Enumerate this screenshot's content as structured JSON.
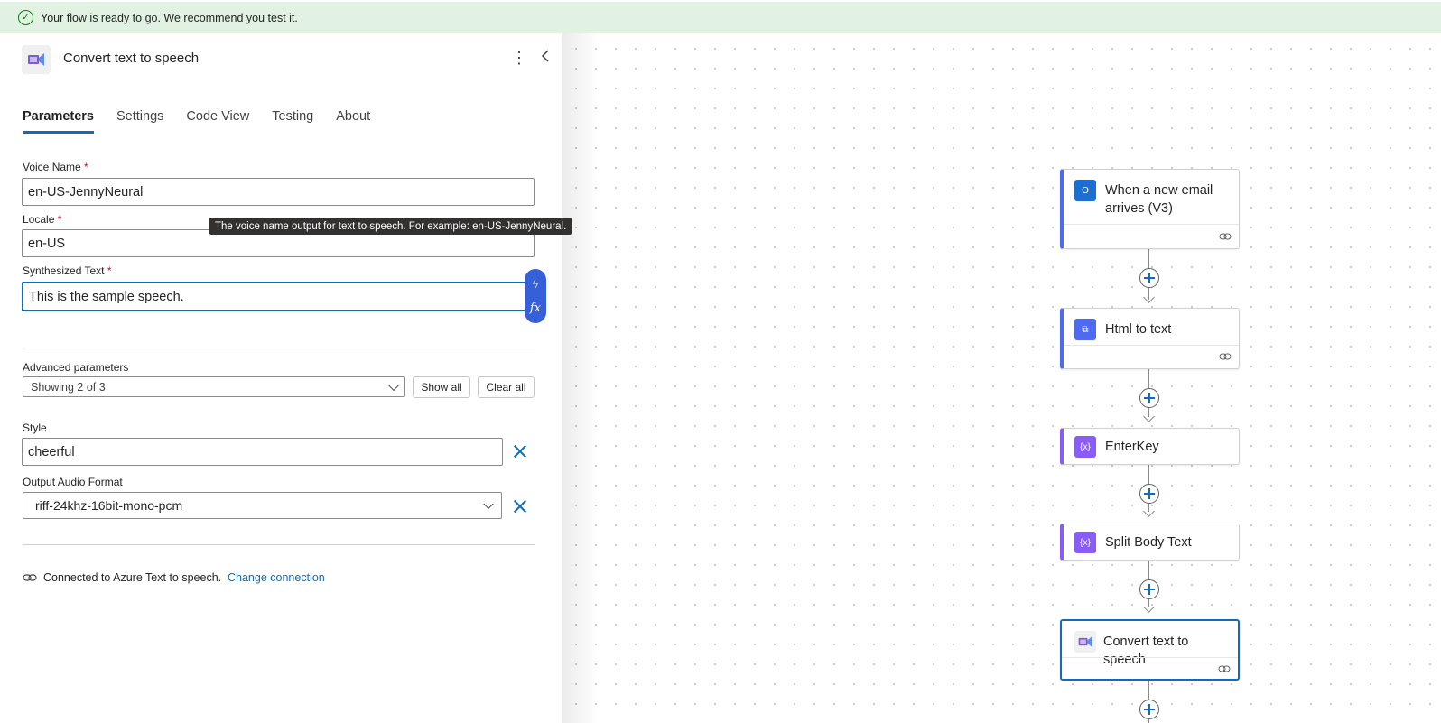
{
  "banner": {
    "message": "Your flow is ready to go. We recommend you test it."
  },
  "panel": {
    "title": "Convert text to speech",
    "tabs": [
      {
        "label": "Parameters",
        "active": true
      },
      {
        "label": "Settings",
        "active": false
      },
      {
        "label": "Code View",
        "active": false
      },
      {
        "label": "Testing",
        "active": false
      },
      {
        "label": "About",
        "active": false
      }
    ],
    "fields": {
      "voice_name": {
        "label": "Voice Name",
        "value": "en-US-JennyNeural",
        "required": "*"
      },
      "locale": {
        "label": "Locale",
        "value": "en-US",
        "required": "*"
      },
      "synth_text": {
        "label": "Synthesized Text",
        "value": "This is the sample speech.",
        "required": "*"
      }
    },
    "tooltip": "The voice name output for text to speech. For example: en-US-JennyNeural.",
    "token_icons": {
      "dynamic": "ϟ",
      "expression": "fx"
    },
    "advanced": {
      "label": "Advanced parameters",
      "selected": "Showing 2 of 3",
      "show_all": "Show all",
      "clear_all": "Clear all"
    },
    "style": {
      "label": "Style",
      "value": "cheerful"
    },
    "output_format": {
      "label": "Output Audio Format",
      "value": "riff-24khz-16bit-mono-pcm"
    },
    "connection": {
      "text": "Connected to Azure Text to speech.",
      "link": "Change connection"
    }
  },
  "flow": {
    "steps": [
      {
        "title": "When a new email arrives (V3)",
        "icon": "outlook-icon",
        "color": "#1c6fd1"
      },
      {
        "title": "Html to text",
        "icon": "html-to-text-icon",
        "color": "#4f6bed"
      },
      {
        "title": "EnterKey",
        "icon": "variable-icon",
        "color": "#8a5cf6"
      },
      {
        "title": "Split Body Text",
        "icon": "variable-icon",
        "color": "#8a5cf6"
      },
      {
        "title": "Convert text to speech",
        "icon": "speech-icon",
        "color": "#0f6cbd"
      }
    ]
  },
  "colors": {
    "accent": "#0f6cbd",
    "banner_bg": "#e2f2e2",
    "success": "#107c10",
    "required": "#c50f1f"
  }
}
